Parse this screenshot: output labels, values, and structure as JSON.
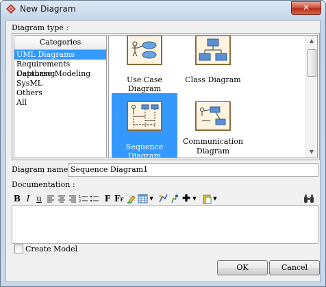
{
  "window": {
    "title": "New Diagram",
    "close_glyph": "✕"
  },
  "diagram_type_label": "Diagram type :",
  "categories": {
    "header": "Categories",
    "items": [
      "UML Diagrams",
      "Requirements Capturing",
      "Database Modeling",
      "SysML",
      "Others",
      "All"
    ],
    "selected": "UML Diagrams"
  },
  "diagrams": [
    {
      "label": "Use Case Diagram",
      "icon": "use-case-diagram-thumbnail"
    },
    {
      "label": "Class Diagram",
      "icon": "class-diagram-thumbnail"
    },
    {
      "label": "Sequence Diagram",
      "icon": "sequence-diagram-thumbnail",
      "selected": true
    },
    {
      "label": "Communication Diagram",
      "label_line1": "Communication",
      "label_line2": "Diagram",
      "icon": "communication-diagram-thumbnail"
    }
  ],
  "diagram_name": {
    "label": "Diagram name :",
    "value": "Sequence Diagram1"
  },
  "documentation": {
    "label": "Documentation :",
    "toolbar": {
      "bold": "B",
      "italic": "I",
      "underline": "u",
      "font": "F",
      "font_size": "F",
      "font_size_sub": "F"
    }
  },
  "create_model": {
    "label": "Create Model",
    "checked": false
  },
  "buttons": {
    "ok": "OK",
    "cancel": "Cancel"
  },
  "colors": {
    "selection": "#3399ff",
    "close_button": "#c9472f",
    "title_gradient": "#c4d6ea"
  }
}
